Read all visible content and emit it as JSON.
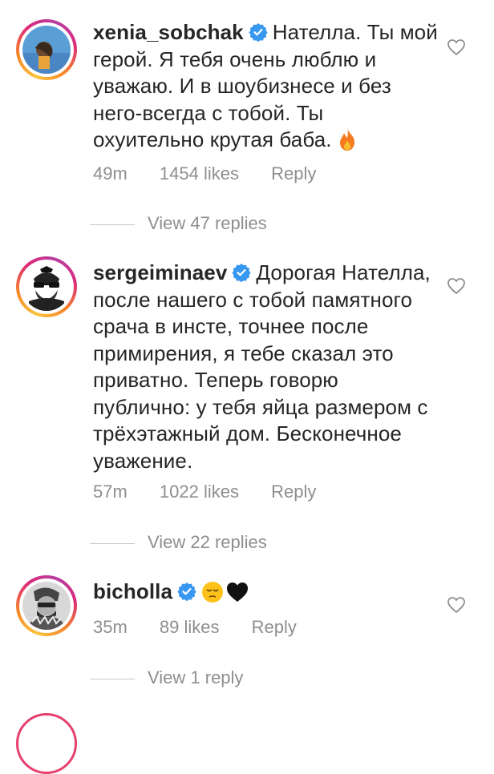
{
  "comments": [
    {
      "username": "xenia_sobchak",
      "verified": true,
      "text": "Нателла. Ты мой герой. Я тебя очень люблю и уважаю. И в шоубизнесе и без него-всегда с тобой. Ты охуительно крутая баба.",
      "emoji_icon": "fire-icon",
      "time": "49m",
      "likes": "1454 likes",
      "reply_label": "Reply",
      "view_replies": "View 47 replies"
    },
    {
      "username": "sergeiminaev",
      "verified": true,
      "text": "Дорогая Нателла, после нашего с тобой памятного срача в инсте, точнее после примирения, я тебе сказал это приватно. Теперь говорю публично: у тебя яйца размером с трёхэтажный дом. Бесконечное уважение.",
      "time": "57m",
      "likes": "1022 likes",
      "reply_label": "Reply",
      "view_replies": "View 22 replies"
    },
    {
      "username": "bicholla",
      "verified": true,
      "text": "",
      "emoji_icons": [
        "pensive-face-icon",
        "black-heart-icon"
      ],
      "time": "35m",
      "likes": "89 likes",
      "reply_label": "Reply",
      "view_replies": "View 1 reply"
    }
  ],
  "colors": {
    "verified_badge": "#3897f0",
    "meta_text": "#8e8e8e",
    "story_ring": "#dd2a7b"
  }
}
